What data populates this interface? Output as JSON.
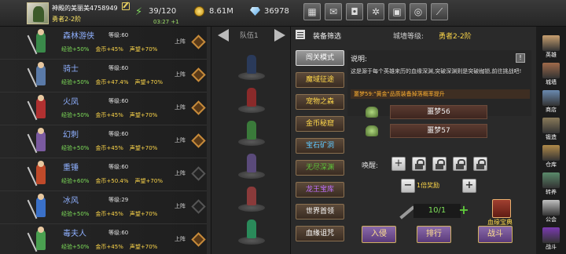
{
  "topbar": {
    "player_name": "神殿的美丽美4758949",
    "player_rank": "勇者2-2阶",
    "energy": "39/120",
    "energy_timer": "03:27 +1",
    "gold": "8.61M",
    "gems": "36978",
    "buttons": [
      "shop-icon",
      "mail-icon",
      "gamepad-icon",
      "settings-icon",
      "gift-icon",
      "color-wheel-icon",
      "sword-icon"
    ]
  },
  "heroes": [
    {
      "name": "森林游侠",
      "level": "等级:60",
      "deploy": "上阵",
      "xp": "经验+50%",
      "gold": "金币+45%",
      "fame": "声望+70%",
      "active": true,
      "color": "#3a8a4a"
    },
    {
      "name": "骑士",
      "level": "等级:60",
      "deploy": "上阵",
      "xp": "经验+50%",
      "gold": "金币+47.4%",
      "fame": "声望+70%",
      "active": true,
      "color": "#5a7aa8"
    },
    {
      "name": "火凤",
      "level": "等级:60",
      "deploy": "上阵",
      "xp": "经验+50%",
      "gold": "金币+45%",
      "fame": "声望+70%",
      "active": true,
      "color": "#b03030"
    },
    {
      "name": "幻刺",
      "level": "等级:60",
      "deploy": "上阵",
      "xp": "经验+50%",
      "gold": "金币+45%",
      "fame": "声望+70%",
      "active": true,
      "color": "#7a5aa0"
    },
    {
      "name": "重锤",
      "level": "等级:60",
      "deploy": "上阵",
      "xp": "经验+60%",
      "gold": "金币+50.4%",
      "fame": "声望+70%",
      "active": false,
      "color": "#c04a2a"
    },
    {
      "name": "冰风",
      "level": "等级:29",
      "deploy": "上阵",
      "xp": "经验+50%",
      "gold": "金币+45%",
      "fame": "声望+70%",
      "active": false,
      "color": "#3a70c8"
    },
    {
      "name": "毒夫人",
      "level": "等级:60",
      "deploy": "上阵",
      "xp": "经验+50%",
      "gold": "金币+45%",
      "fame": "声望+70%",
      "active": true,
      "color": "#4aa050"
    }
  ],
  "team": {
    "label": "队伍1",
    "slots": [
      "#2a3a5a",
      "#8a2a2a",
      "#3a7a3a",
      "#5a4a7a",
      "#8a3a3a",
      "#2a8a5a"
    ]
  },
  "panel": {
    "filter_label": "装备筛选",
    "tower_label": "城墙等级:",
    "tower_value": "勇者2-2阶",
    "desc_title": "说明:",
    "info_icon": "!",
    "desc_text": "这是源于每个英雄来历的血缘深渊,突破深渊则是突破枷锁,前往挑战吧!",
    "drop_line": "噩梦59:\"黄金\"品质装备掉落概率提升",
    "requirements": [
      "噩梦56",
      "噩梦57"
    ],
    "awaken_label": "唤醒:",
    "multiplier": "1倍奖励",
    "minus": "−",
    "plus": "+",
    "keys": "10/1",
    "key_add": "+",
    "bloodline_label": "血缘宝典",
    "actions": [
      "入侵",
      "排行",
      "战斗"
    ]
  },
  "dungeons": [
    {
      "label": "闯关模式",
      "color": "#ffffff",
      "selected": true
    },
    {
      "label": "魔域征途",
      "color": "#ffd84a",
      "selected": false
    },
    {
      "label": "宠物之森",
      "color": "#ffd84a",
      "selected": false
    },
    {
      "label": "金币秘窟",
      "color": "#ffd84a",
      "selected": false
    },
    {
      "label": "宝石矿洞",
      "color": "#5ec8ff",
      "selected": false
    },
    {
      "label": "无尽深渊",
      "color": "#5ec83a",
      "selected": false
    },
    {
      "label": "龙王宝库",
      "color": "#c070ff",
      "selected": false
    },
    {
      "label": "世界首领",
      "color": "#ffffff",
      "selected": false
    },
    {
      "label": "血缘诅咒",
      "color": "#ffffff",
      "selected": false
    }
  ],
  "sidebar": [
    {
      "label": "英雄",
      "icon": "hero-icon",
      "color": "#c8a070"
    },
    {
      "label": "城墙",
      "icon": "wall-icon",
      "color": "#a06a4a"
    },
    {
      "label": "商店",
      "icon": "store-icon",
      "color": "#6a8ab0"
    },
    {
      "label": "锻造",
      "icon": "forge-icon",
      "color": "#8a7a5a"
    },
    {
      "label": "仓库",
      "icon": "storage-icon",
      "color": "#b08a4a"
    },
    {
      "label": "转养",
      "icon": "pet-icon",
      "color": "#5a8a6a"
    },
    {
      "label": "公会",
      "icon": "guild-icon",
      "color": "#c0c0c0"
    },
    {
      "label": "战斗",
      "icon": "battle-icon",
      "color": "#7a3ab0"
    }
  ]
}
